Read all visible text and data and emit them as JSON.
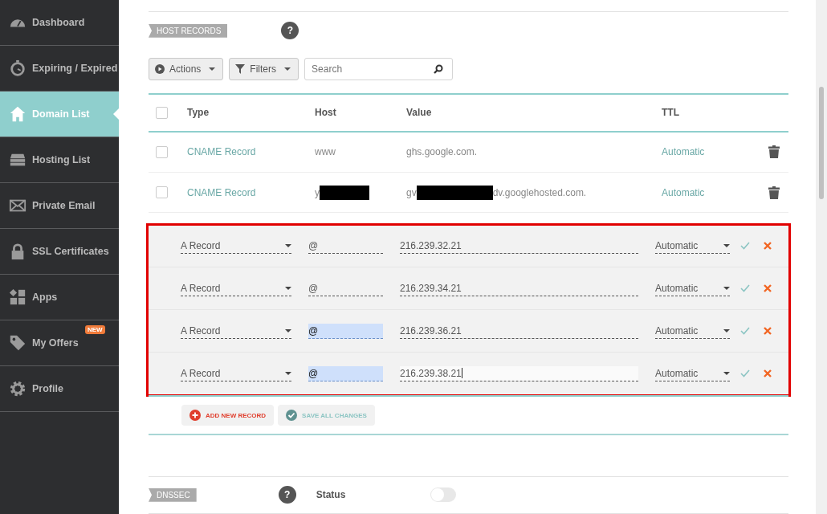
{
  "sidebar": {
    "items": [
      {
        "label": "Dashboard",
        "selected": false
      },
      {
        "label": "Expiring / Expired",
        "selected": false
      },
      {
        "label": "Domain List",
        "selected": true
      },
      {
        "label": "Hosting List",
        "selected": false
      },
      {
        "label": "Private Email",
        "selected": false
      },
      {
        "label": "SSL Certificates",
        "selected": false
      },
      {
        "label": "Apps",
        "selected": false
      },
      {
        "label": "My Offers",
        "selected": false,
        "badge": "NEW"
      },
      {
        "label": "Profile",
        "selected": false
      }
    ]
  },
  "host_records": {
    "tag": "HOST RECORDS",
    "help": "?",
    "toolbar": {
      "actions": "Actions",
      "filters": "Filters",
      "search": {
        "placeholder": "Search"
      }
    },
    "table": {
      "select_all_checked": false,
      "columns": [
        "Type",
        "Host",
        "Value",
        "TTL"
      ],
      "rows": [
        {
          "type": "CNAME Record",
          "host": "www",
          "value": "ghs.google.com.",
          "ttl": "Automatic",
          "checked": false
        },
        {
          "type": "CNAME Record",
          "host": "y",
          "value": "gv",
          "value_end": "dv.googlehosted.com.",
          "redacted": true,
          "ttl": "Automatic",
          "checked": false
        }
      ],
      "edit_rows": [
        {
          "type": "A Record",
          "host": "@",
          "value": "216.239.32.21",
          "ttl": "Automatic",
          "host_highlighted": false,
          "editing": false
        },
        {
          "type": "A Record",
          "host": "@",
          "value": "216.239.34.21",
          "ttl": "Automatic",
          "host_highlighted": false,
          "editing": false
        },
        {
          "type": "A Record",
          "host": "@",
          "value": "216.239.36.21",
          "ttl": "Automatic",
          "host_highlighted": true,
          "editing": false
        },
        {
          "type": "A Record",
          "host": "@",
          "value": "216.239.38.21",
          "ttl": "Automatic",
          "host_highlighted": true,
          "editing": true
        }
      ]
    },
    "add_button": "ADD NEW RECORD",
    "save_button": "SAVE ALL CHANGES"
  },
  "dnssec": {
    "tag": "DNSSEC",
    "help": "?",
    "status_label": "Status",
    "on": false
  }
}
